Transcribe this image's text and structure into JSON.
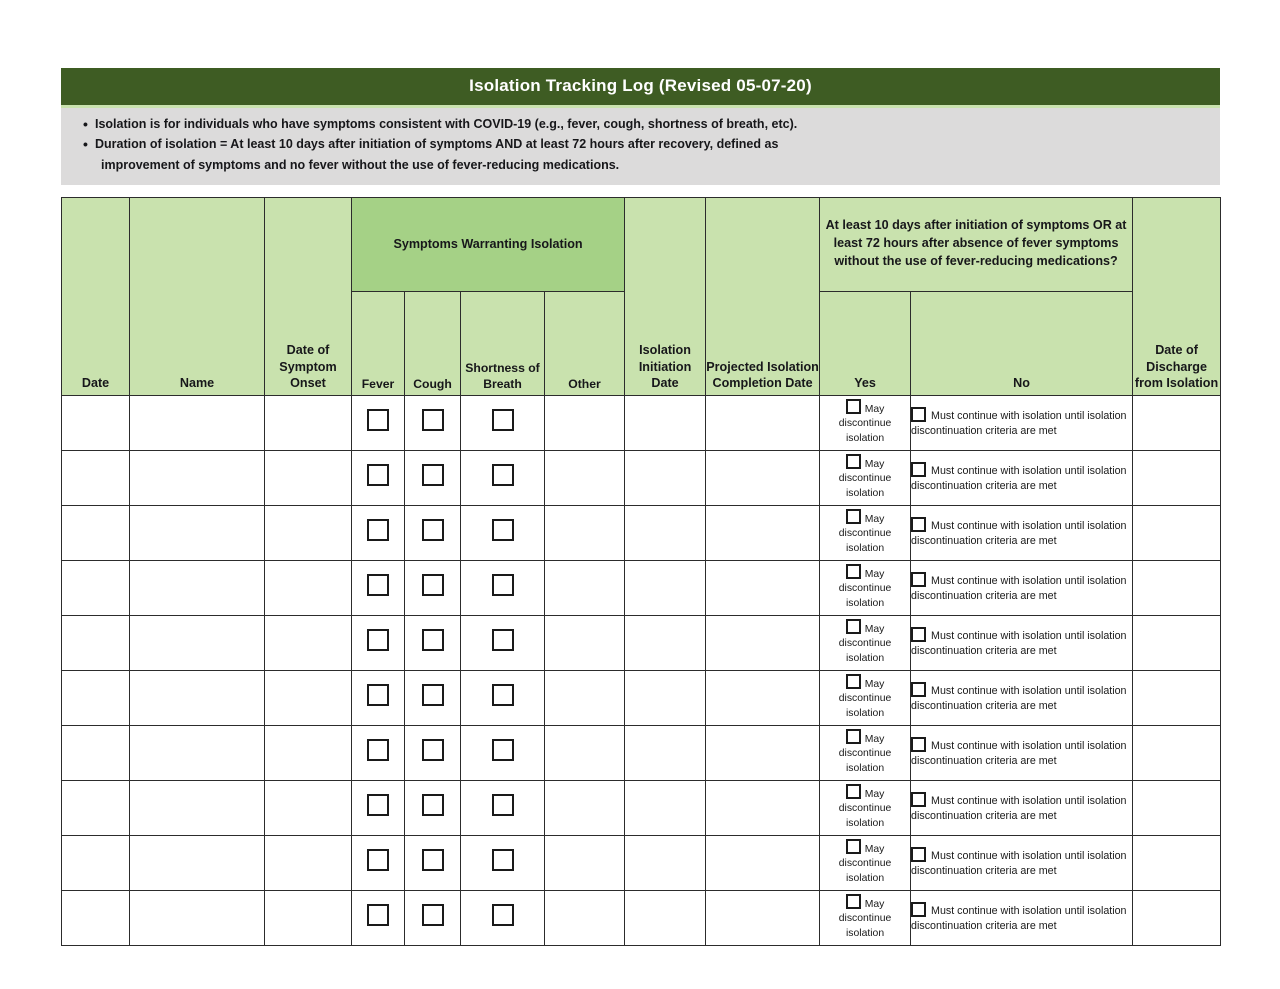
{
  "document": {
    "title": "Isolation Tracking Log  (Revised 05-07-20)",
    "notes": [
      {
        "text": "Isolation is for individuals who have symptoms consistent with COVID-19 (e.g., fever, cough, shortness of breath, etc).",
        "bulleted": true
      },
      {
        "text": "Duration of isolation = At least 10 days after initiation of symptoms AND at least 72 hours after recovery, defined as",
        "bulleted": true
      },
      {
        "text": "improvement of symptoms and no fever without the use of fever-reducing medications.",
        "bulleted": false
      }
    ]
  },
  "table": {
    "group_headers": {
      "symptoms": "Symptoms Warranting Isolation",
      "criteria_question": "At least 10 days after initiation of symptoms OR at least 72 hours after absence of fever symptoms without the use of fever-reducing medications?"
    },
    "columns": {
      "date": "Date",
      "name": "Name",
      "date_of_symptom_onset": "Date of Symptom Onset",
      "fever": "Fever",
      "cough": "Cough",
      "shortness_of_breath": "Shortness of Breath",
      "other": "Other",
      "isolation_initiation_date": "Isolation Initiation Date",
      "projected_isolation_completion_date": "Projected Isolation Completion Date",
      "yes": "Yes",
      "no": "No",
      "date_of_discharge_from_isolation": "Date of Discharge from Isolation"
    },
    "row_options": {
      "yes_option": "May discontinue isolation",
      "yes_option_line1": "May",
      "yes_option_line2": "discontinue",
      "yes_option_line3": "isolation",
      "no_option": "Must continue with isolation until isolation discontinuation criteria are met"
    },
    "row_count": 10,
    "rows": [
      {
        "date": "",
        "name": "",
        "onset": "",
        "other": "",
        "initiation": "",
        "projected": "",
        "discharge": "",
        "fever_checked": false,
        "cough_checked": false,
        "sob_checked": false,
        "yes_checked": false,
        "no_checked": false
      },
      {
        "date": "",
        "name": "",
        "onset": "",
        "other": "",
        "initiation": "",
        "projected": "",
        "discharge": "",
        "fever_checked": false,
        "cough_checked": false,
        "sob_checked": false,
        "yes_checked": false,
        "no_checked": false
      },
      {
        "date": "",
        "name": "",
        "onset": "",
        "other": "",
        "initiation": "",
        "projected": "",
        "discharge": "",
        "fever_checked": false,
        "cough_checked": false,
        "sob_checked": false,
        "yes_checked": false,
        "no_checked": false
      },
      {
        "date": "",
        "name": "",
        "onset": "",
        "other": "",
        "initiation": "",
        "projected": "",
        "discharge": "",
        "fever_checked": false,
        "cough_checked": false,
        "sob_checked": false,
        "yes_checked": false,
        "no_checked": false
      },
      {
        "date": "",
        "name": "",
        "onset": "",
        "other": "",
        "initiation": "",
        "projected": "",
        "discharge": "",
        "fever_checked": false,
        "cough_checked": false,
        "sob_checked": false,
        "yes_checked": false,
        "no_checked": false
      },
      {
        "date": "",
        "name": "",
        "onset": "",
        "other": "",
        "initiation": "",
        "projected": "",
        "discharge": "",
        "fever_checked": false,
        "cough_checked": false,
        "sob_checked": false,
        "yes_checked": false,
        "no_checked": false
      },
      {
        "date": "",
        "name": "",
        "onset": "",
        "other": "",
        "initiation": "",
        "projected": "",
        "discharge": "",
        "fever_checked": false,
        "cough_checked": false,
        "sob_checked": false,
        "yes_checked": false,
        "no_checked": false
      },
      {
        "date": "",
        "name": "",
        "onset": "",
        "other": "",
        "initiation": "",
        "projected": "",
        "discharge": "",
        "fever_checked": false,
        "cough_checked": false,
        "sob_checked": false,
        "yes_checked": false,
        "no_checked": false
      },
      {
        "date": "",
        "name": "",
        "onset": "",
        "other": "",
        "initiation": "",
        "projected": "",
        "discharge": "",
        "fever_checked": false,
        "cough_checked": false,
        "sob_checked": false,
        "yes_checked": false,
        "no_checked": false
      },
      {
        "date": "",
        "name": "",
        "onset": "",
        "other": "",
        "initiation": "",
        "projected": "",
        "discharge": "",
        "fever_checked": false,
        "cough_checked": false,
        "sob_checked": false,
        "yes_checked": false,
        "no_checked": false
      }
    ]
  },
  "colors": {
    "title_band": "#3e5c23",
    "header_cell": "#c9e2ae",
    "group_header_cell": "#a5d186",
    "notes_band": "#dcdbdb",
    "grid_line": "#2c2c2c"
  }
}
